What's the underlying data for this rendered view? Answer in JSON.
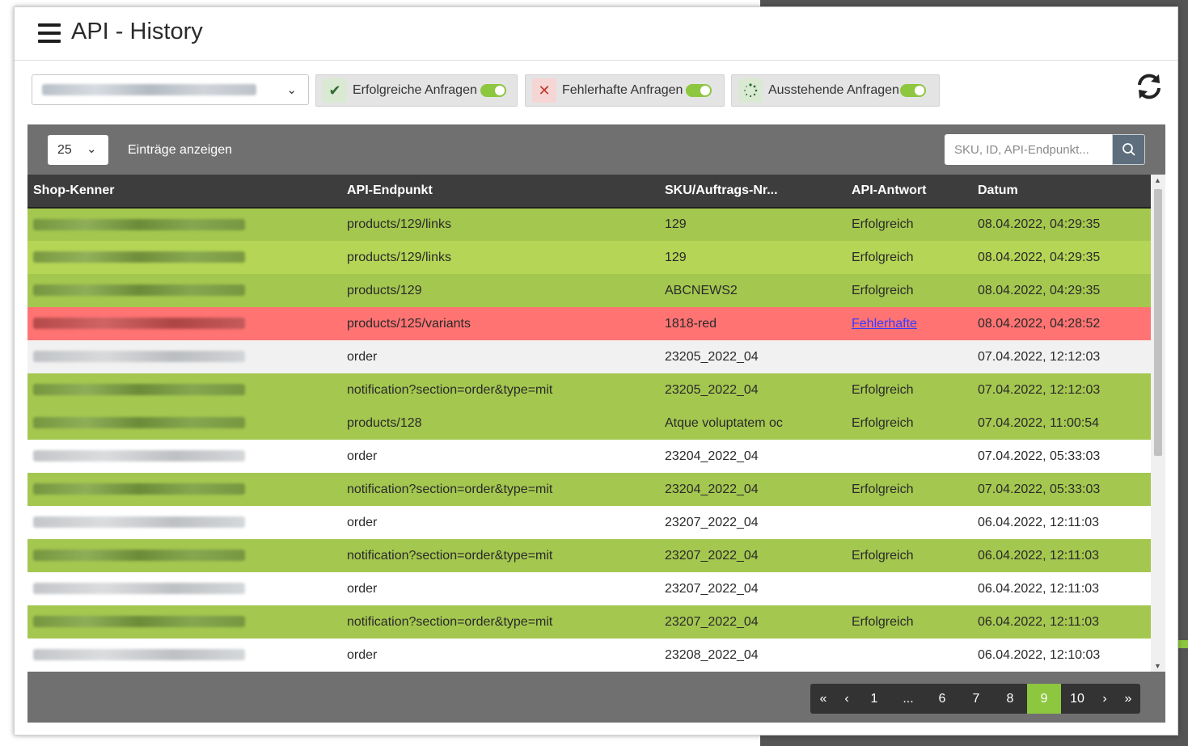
{
  "app": {
    "title": "API - History"
  },
  "toolbar": {
    "shop_select_value": "https://gambioflorsch.shopware.de",
    "filters": [
      {
        "label": "Erfolgreiche Anfragen",
        "icon": "check-icon",
        "enabled": true
      },
      {
        "label": "Fehlerhafte Anfragen",
        "icon": "x-icon",
        "enabled": true
      },
      {
        "label": "Ausstehende Anfragen",
        "icon": "spinner-icon",
        "enabled": true
      }
    ],
    "refresh_icon": "refresh-icon"
  },
  "colors": {
    "success": "#a4c74f",
    "success_light": "#b5d556",
    "error": "#ff7373",
    "accent": "#8dc63f",
    "header": "#3d3d3d",
    "panel": "#707070"
  },
  "list": {
    "page_size": "25",
    "entries_label": "Einträge anzeigen",
    "search_placeholder": "SKU, ID, API-Endpunkt..."
  },
  "table": {
    "columns": [
      "Shop-Kenner",
      "API-Endpunkt",
      "SKU/Auftrags-Nr...",
      "API-Antwort",
      "Datum"
    ],
    "rows": [
      {
        "shop": "https://gambio4florsch.shopware.de",
        "endpoint": "products/129/links",
        "sku": "129",
        "response": "Erfolgreich",
        "date": "08.04.2022, 04:29:35",
        "status": "ok"
      },
      {
        "shop": "https://gambioflorsch.shopware.de",
        "endpoint": "products/129/links",
        "sku": "129",
        "response": "Erfolgreich",
        "date": "08.04.2022, 04:29:35",
        "status": "ok-light"
      },
      {
        "shop": "https://gambioflorsch.shopware.de",
        "endpoint": "products/129",
        "sku": "ABCNEWS2",
        "response": "Erfolgreich",
        "date": "08.04.2022, 04:29:35",
        "status": "ok"
      },
      {
        "shop": "https://gambioflorsch.shopware.de",
        "endpoint": "products/125/variants",
        "sku": "1818-red",
        "response": "Fehlerhafte",
        "date": "08.04.2022, 04:28:52",
        "status": "err"
      },
      {
        "shop": "https://gambio4florsch.shopware.de",
        "endpoint": "order",
        "sku": "23205_2022_04",
        "response": "",
        "date": "07.04.2022, 12:12:03",
        "status": "gray"
      },
      {
        "shop": "https://gambio4florsch.shopware.de",
        "endpoint": "notification?section=order&type=mit",
        "sku": "23205_2022_04",
        "response": "Erfolgreich",
        "date": "07.04.2022, 12:12:03",
        "status": "ok"
      },
      {
        "shop": "https://gambioflorsch.shopware.de",
        "endpoint": "products/128",
        "sku": "Atque voluptatem oc",
        "response": "Erfolgreich",
        "date": "07.04.2022, 11:00:54",
        "status": "ok"
      },
      {
        "shop": "https://gambioflorsch.shopware.de",
        "endpoint": "order",
        "sku": "23204_2022_04",
        "response": "",
        "date": "07.04.2022, 05:33:03",
        "status": "white"
      },
      {
        "shop": "https://gambioflorsch.shopware.de",
        "endpoint": "notification?section=order&type=mit",
        "sku": "23204_2022_04",
        "response": "Erfolgreich",
        "date": "07.04.2022, 05:33:03",
        "status": "ok"
      },
      {
        "shop": "https://gambio4florsch.shopware.de",
        "endpoint": "order",
        "sku": "23207_2022_04",
        "response": "",
        "date": "06.04.2022, 12:11:03",
        "status": "white"
      },
      {
        "shop": "https://gambio4florsch.shopware.de",
        "endpoint": "notification?section=order&type=mit",
        "sku": "23207_2022_04",
        "response": "Erfolgreich",
        "date": "06.04.2022, 12:11:03",
        "status": "ok"
      },
      {
        "shop": "https://gambioflorsch.shopware.de",
        "endpoint": "order",
        "sku": "23207_2022_04",
        "response": "",
        "date": "06.04.2022, 12:11:03",
        "status": "white"
      },
      {
        "shop": "https://gambioflorsch.shopware.de",
        "endpoint": "notification?section=order&type=mit",
        "sku": "23207_2022_04",
        "response": "Erfolgreich",
        "date": "06.04.2022, 12:11:03",
        "status": "ok"
      },
      {
        "shop": "https://gambioflorsch.shopware.de",
        "endpoint": "order",
        "sku": "23208_2022_04",
        "response": "",
        "date": "06.04.2022, 12:10:03",
        "status": "white"
      }
    ]
  },
  "pagination": {
    "items": [
      "«",
      "‹",
      "1",
      "...",
      "6",
      "7",
      "8",
      "9",
      "10",
      "›",
      "»"
    ],
    "active": "9"
  }
}
